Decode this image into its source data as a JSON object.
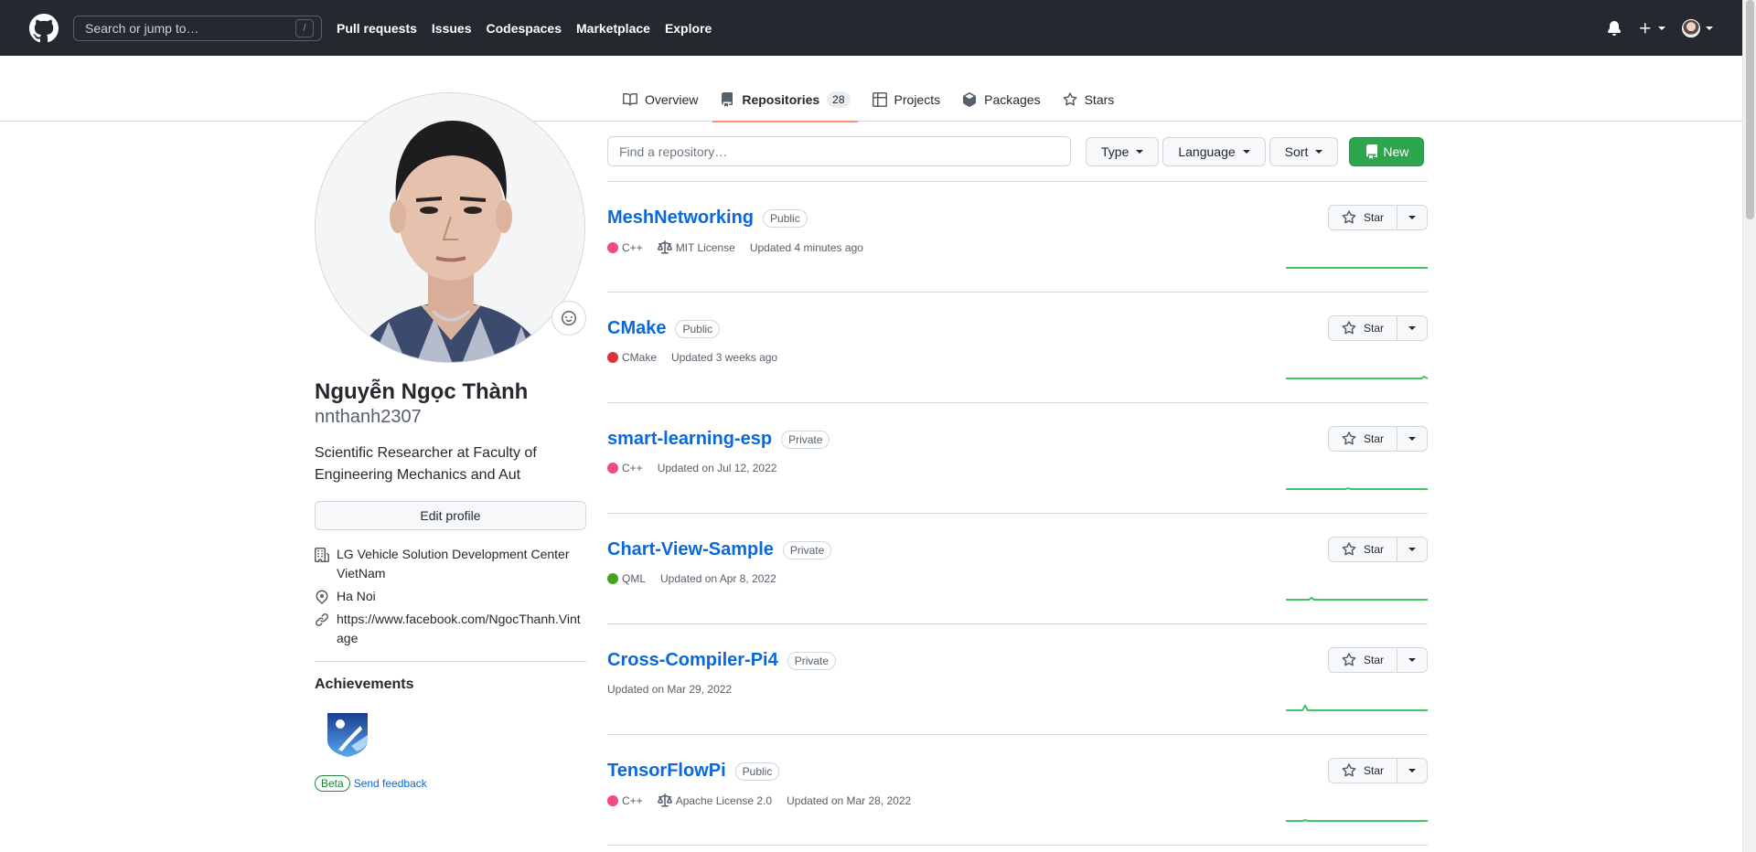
{
  "header": {
    "search_placeholder": "Search or jump to…",
    "search_shortcut": "/",
    "nav": [
      "Pull requests",
      "Issues",
      "Codespaces",
      "Marketplace",
      "Explore"
    ]
  },
  "tabs": {
    "overview": "Overview",
    "repositories": "Repositories",
    "repositories_count": "28",
    "projects": "Projects",
    "packages": "Packages",
    "stars": "Stars"
  },
  "profile": {
    "fullname": "Nguyễn Ngọc Thành",
    "username": "nnthanh2307",
    "bio": "Scientific Researcher at Faculty of Engineering Mechanics and Aut",
    "edit_label": "Edit profile",
    "company": "LG Vehicle Solution Development Center VietNam",
    "location": "Ha Noi",
    "website": "https://www.facebook.com/NgocThanh.Vintage",
    "achievements_title": "Achievements",
    "beta_label": "Beta",
    "feedback_label": "Send feedback"
  },
  "filters": {
    "find_placeholder": "Find a repository…",
    "type": "Type",
    "language": "Language",
    "sort": "Sort",
    "new": "New"
  },
  "star_label": "Star",
  "repos": [
    {
      "name": "MeshNetworking",
      "visibility": "Public",
      "language": "C++",
      "lang_color": "#f34b7d",
      "license": "MIT License",
      "updated": "Updated 4 minutes ago"
    },
    {
      "name": "CMake",
      "visibility": "Public",
      "language": "CMake",
      "lang_color": "#DA3434",
      "license": "",
      "updated": "Updated 3 weeks ago"
    },
    {
      "name": "smart-learning-esp",
      "visibility": "Private",
      "language": "C++",
      "lang_color": "#f34b7d",
      "license": "",
      "updated": "Updated on Jul 12, 2022"
    },
    {
      "name": "Chart-View-Sample",
      "visibility": "Private",
      "language": "QML",
      "lang_color": "#44a51c",
      "license": "",
      "updated": "Updated on Apr 8, 2022"
    },
    {
      "name": "Cross-Compiler-Pi4",
      "visibility": "Private",
      "language": "",
      "lang_color": "",
      "license": "",
      "updated": "Updated on Mar 29, 2022"
    },
    {
      "name": "TensorFlowPi",
      "visibility": "Public",
      "language": "C++",
      "lang_color": "#f34b7d",
      "license": "Apache License 2.0",
      "updated": "Updated on Mar 28, 2022"
    }
  ]
}
